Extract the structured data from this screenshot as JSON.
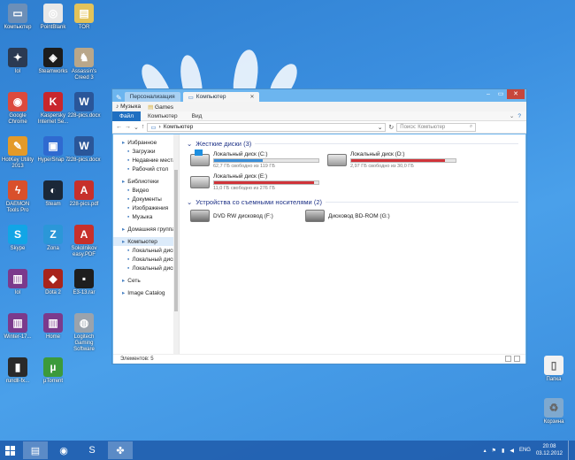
{
  "desktop_icons": [
    {
      "label": "Компьютер",
      "icon": "computer-icon",
      "color": "#6c8fb8",
      "glyph": "▭"
    },
    {
      "label": "PointBlank",
      "icon": "pointblank-icon",
      "color": "#e8e8e8",
      "glyph": "◎"
    },
    {
      "label": "TOR",
      "icon": "folder-icon",
      "color": "#e3c35a",
      "glyph": "▤"
    },
    {
      "label": "lol",
      "icon": "game-icon",
      "color": "#2b3a52",
      "glyph": "✦"
    },
    {
      "label": "Steamworks",
      "icon": "steamworks-icon",
      "color": "#1c1c1c",
      "glyph": "◈"
    },
    {
      "label": "Assassin's Creed 3",
      "icon": "assassins-creed-icon",
      "color": "#b9a78a",
      "glyph": "♞"
    },
    {
      "label": "Google Chrome",
      "icon": "chrome-icon",
      "color": "#dc4a3d",
      "glyph": "◉"
    },
    {
      "label": "Kaspersky Internet Se...",
      "icon": "kaspersky-icon",
      "color": "#c9262c",
      "glyph": "K"
    },
    {
      "label": "228-pics.docx",
      "icon": "word-doc-icon",
      "color": "#2a5699",
      "glyph": "W"
    },
    {
      "label": "HotKey Utility 2013",
      "icon": "hotkey-icon",
      "color": "#e49a29",
      "glyph": "✎"
    },
    {
      "label": "HyperSnap 7",
      "icon": "hypersnap-icon",
      "color": "#2f6ad0",
      "glyph": "▣"
    },
    {
      "label": "228-pics.docx",
      "icon": "word-doc-icon",
      "color": "#2a5699",
      "glyph": "W"
    },
    {
      "label": "DAEMON Tools Pro",
      "icon": "daemon-tools-icon",
      "color": "#d9502b",
      "glyph": "ϟ"
    },
    {
      "label": "Steam",
      "icon": "steam-icon",
      "color": "#1b2838",
      "glyph": "◐"
    },
    {
      "label": "228-pics.pdf",
      "icon": "pdf-icon",
      "color": "#c7302b",
      "glyph": "A"
    },
    {
      "label": "Skype",
      "icon": "skype-icon",
      "color": "#12a5e6",
      "glyph": "S"
    },
    {
      "label": "Zona",
      "icon": "zona-icon",
      "color": "#2b97d8",
      "glyph": "Z"
    },
    {
      "label": "Sokolnikov easy.PDF",
      "icon": "pdf-icon",
      "color": "#c7302b",
      "glyph": "A"
    },
    {
      "label": "lol",
      "icon": "winrar-icon",
      "color": "#7b3a8c",
      "glyph": "▥"
    },
    {
      "label": "Dota 2",
      "icon": "dota2-icon",
      "color": "#a8241c",
      "glyph": "◆"
    },
    {
      "label": "E3-13.rar",
      "icon": "game-icon",
      "color": "#1e1e1e",
      "glyph": "▪"
    },
    {
      "label": "Winter-17...",
      "icon": "winrar-icon",
      "color": "#7b3a8c",
      "glyph": "▥"
    },
    {
      "label": "Home",
      "icon": "winrar-icon",
      "color": "#7b3a8c",
      "glyph": "▥"
    },
    {
      "label": "Logitech Gaming Software",
      "icon": "logitech-icon",
      "color": "#9aa3ad",
      "glyph": "◍"
    },
    {
      "label": "rundll-fx...",
      "icon": "file-icon",
      "color": "#2a2a2a",
      "glyph": "▮"
    },
    {
      "label": "µTorrent",
      "icon": "utorrent-icon",
      "color": "#3c9a3b",
      "glyph": "µ"
    }
  ],
  "right_icons": [
    {
      "label": "Папка",
      "icon": "document-icon"
    },
    {
      "label": "Корзина",
      "icon": "recycle-bin-icon"
    }
  ],
  "window": {
    "tabs": [
      {
        "label": "Персонализация",
        "active": false
      },
      {
        "label": "Компьютер",
        "active": true
      }
    ],
    "favorites": [
      "Музыка",
      "Games"
    ],
    "ribbon_tabs": [
      "Файл",
      "Компьютер",
      "Вид"
    ],
    "address": "Компьютер",
    "search_placeholder": "Поиск: Компьютер",
    "nav": [
      {
        "label": "Избранное",
        "icon": "star-icon",
        "level": 0
      },
      {
        "label": "Загрузки",
        "icon": "downloads-icon",
        "level": 1
      },
      {
        "label": "Недавние места",
        "icon": "recent-icon",
        "level": 1
      },
      {
        "label": "Рабочий стол",
        "icon": "desktop-icon",
        "level": 1
      },
      {
        "label": "Библиотеки",
        "icon": "library-icon",
        "level": 0
      },
      {
        "label": "Видео",
        "icon": "video-icon",
        "level": 1
      },
      {
        "label": "Документы",
        "icon": "documents-icon",
        "level": 1
      },
      {
        "label": "Изображения",
        "icon": "pictures-icon",
        "level": 1
      },
      {
        "label": "Музыка",
        "icon": "music-icon",
        "level": 1
      },
      {
        "label": "Домашняя группа",
        "icon": "homegroup-icon",
        "level": 0
      },
      {
        "label": "Компьютер",
        "icon": "computer-icon",
        "level": 0
      },
      {
        "label": "Локальный диск",
        "icon": "drive-icon",
        "level": 1
      },
      {
        "label": "Локальный диск",
        "icon": "drive-icon",
        "level": 1
      },
      {
        "label": "Локальный диск",
        "icon": "drive-icon",
        "level": 1
      },
      {
        "label": "Сеть",
        "icon": "network-icon",
        "level": 0
      },
      {
        "label": "Image Catalog",
        "icon": "image-catalog-icon",
        "level": 0
      }
    ],
    "hard_drives_title": "Жесткие диски (3)",
    "drives": [
      {
        "name": "Локальный диск (C:)",
        "free": "62,7 ГБ свободно из 119 ГБ",
        "used_fraction": 0.47,
        "color": "#3a8fd9",
        "system": true
      },
      {
        "name": "Локальный диск (D:)",
        "free": "2,97 ГБ свободно из 30,0 ГБ",
        "used_fraction": 0.9,
        "color": "#d0343a",
        "system": false
      },
      {
        "name": "Локальный диск (E:)",
        "free": "11,0 ГБ свободно из 276 ГБ",
        "used_fraction": 0.96,
        "color": "#d0343a",
        "system": false
      }
    ],
    "removable_title": "Устройства со съемными носителями (2)",
    "removable": [
      {
        "name": "DVD RW дисковод (F:)"
      },
      {
        "name": "Дисковод BD-ROM (G:)"
      }
    ],
    "status": "Элементов: 5"
  },
  "taskbar": {
    "items": [
      {
        "icon": "explorer-icon",
        "glyph": "▤",
        "active": true
      },
      {
        "icon": "chrome-icon",
        "glyph": "◉",
        "active": false
      },
      {
        "icon": "skype-icon",
        "glyph": "S",
        "active": false
      },
      {
        "icon": "app-icon",
        "glyph": "✤",
        "active": true
      }
    ],
    "lang": "ENG",
    "time": "20:08",
    "date": "03.12.2012"
  }
}
